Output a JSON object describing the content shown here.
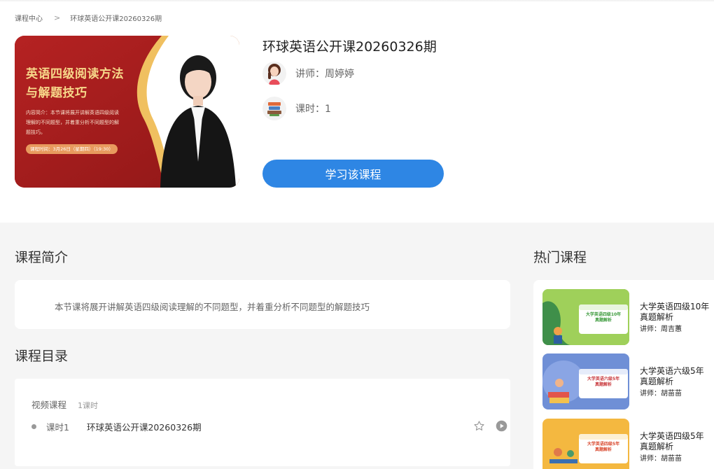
{
  "breadcrumb": {
    "home": "课程中心",
    "separator": ">",
    "current": "环球英语公开课20260326期"
  },
  "cover": {
    "title_line1": "英语四级阅读方法",
    "title_line2": "与解题技巧",
    "desc": "内容简介：本节课将展开讲解英语四级阅读理解的不同题型，并着重分析不同题型的解题技巧。",
    "time": "课程时间：3月26日（星期四）（19:30）"
  },
  "course": {
    "title": "环球英语公开课20260326期",
    "teacher_label": "讲师：周婷婷",
    "hours_label": "课时：1",
    "study_button": "学习该课程"
  },
  "intro": {
    "heading": "课程简介",
    "text": "本节课将展开讲解英语四级阅读理解的不同题型，并着重分析不同题型的解题技巧"
  },
  "catalog": {
    "heading": "课程目录",
    "group": "视频课程",
    "group_count": "1课时",
    "lessons": [
      {
        "num": "课时1",
        "name": "环球英语公开课20260326期"
      }
    ]
  },
  "hot": {
    "heading": "热门课程",
    "items": [
      {
        "name": "大学英语四级10年真题解析",
        "teacher": "讲师：周吉蕙",
        "thumb_label": "大学英语四级10年\n真题解析",
        "bg": "#8cc44a"
      },
      {
        "name": "大学英语六级5年真题解析",
        "teacher": "讲师：胡苗苗",
        "thumb_label": "大学英语六级5年\n真题解析",
        "bg": "#6f8fd6"
      },
      {
        "name": "大学英语四级5年真题解析",
        "teacher": "讲师：胡苗苗",
        "thumb_label": "大学英语四级5年\n真题解析",
        "bg": "#f1b23c"
      }
    ]
  },
  "colors": {
    "primary": "#2e86e4",
    "cover_bg": "#a51d1d",
    "cover_gold": "#f7d88a"
  },
  "icons": {
    "teacher_avatar": "woman-avatar-icon",
    "hours_avatar": "books-icon",
    "favorite": "star-icon",
    "play": "play-circle-icon"
  }
}
